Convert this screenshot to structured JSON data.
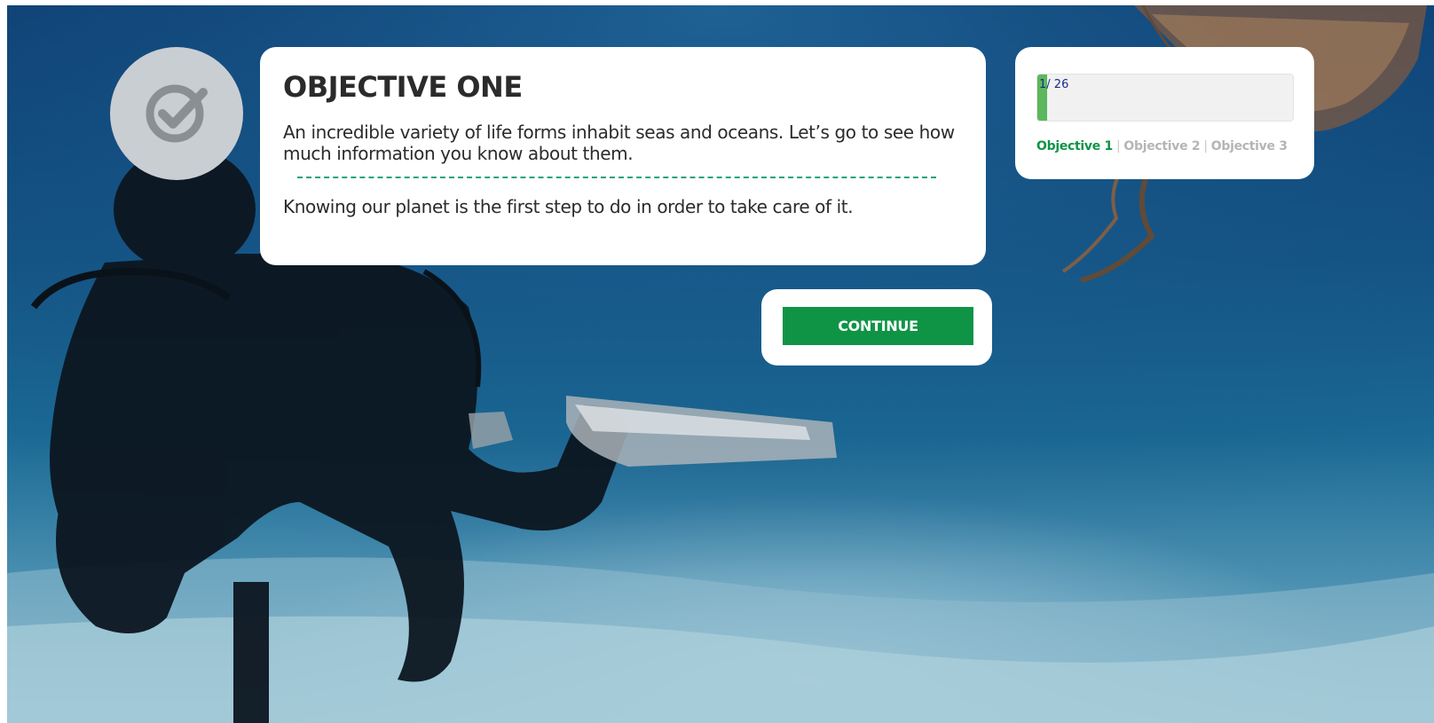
{
  "objective_card": {
    "title": "OBJECTIVE ONE",
    "description": "An incredible variety of life forms inhabit seas and oceans. Let’s go to see how much information you know about them.",
    "tagline": "Knowing our planet is the first step to do in order to take care of it."
  },
  "actions": {
    "continue_label": "CONTINUE"
  },
  "progress": {
    "current": "1",
    "total_label": "/ 26",
    "fraction": 0.038,
    "objectives": [
      {
        "label": "Objective 1",
        "active": true
      },
      {
        "label": "Objective 2",
        "active": false
      },
      {
        "label": "Objective 3",
        "active": false
      }
    ],
    "separator": "|"
  },
  "icons": {
    "badge": "check-circle-icon"
  },
  "colors": {
    "accent_green": "#0f9446",
    "progress_fill": "#5cb85c",
    "inactive_gray": "#b5b5b5",
    "badge_bg": "#c9ced2",
    "divider": "#1aa37a"
  }
}
